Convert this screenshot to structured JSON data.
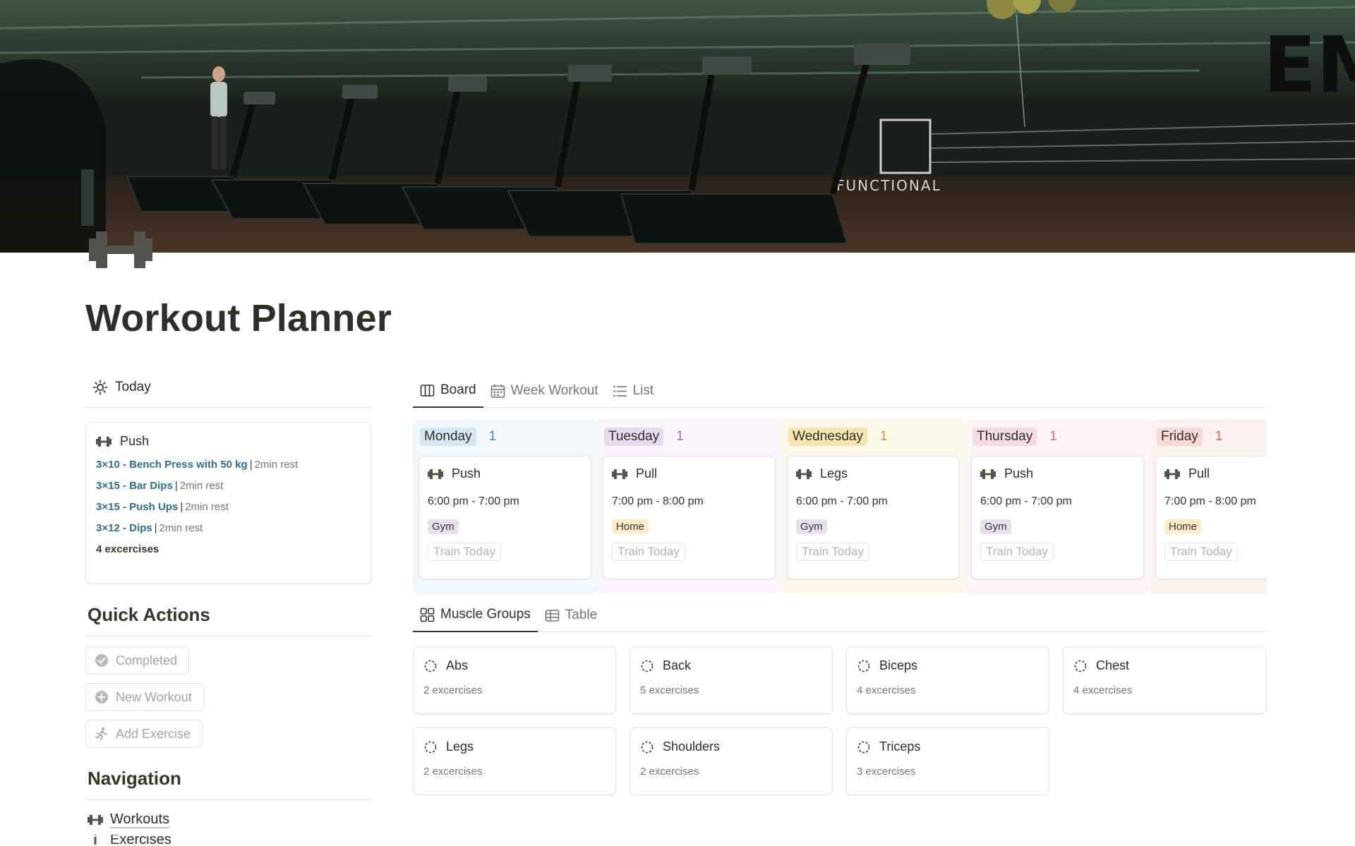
{
  "page": {
    "title": "Workout Planner",
    "icon": "dumbbell-icon",
    "cover": "gym-treadmills-photo"
  },
  "today": {
    "tab_label": "Today",
    "card": {
      "title": "Push",
      "exercises": [
        {
          "name": "3×10 - Bench Press with 50 kg",
          "rest": "2min rest"
        },
        {
          "name": "3×15 - Bar Dips",
          "rest": "2min rest"
        },
        {
          "name": "3×15 - Push Ups",
          "rest": "2min rest"
        },
        {
          "name": "3×12 - Dips",
          "rest": "2min rest"
        }
      ],
      "separator": "|",
      "count": "4 excercises"
    }
  },
  "quick_actions": {
    "heading": "Quick Actions",
    "buttons": [
      {
        "label": "Completed",
        "icon": "check-circle-icon"
      },
      {
        "label": "New Workout",
        "icon": "plus-circle-icon"
      },
      {
        "label": "Add Exercise",
        "icon": "running-person-icon"
      }
    ]
  },
  "navigation": {
    "heading": "Navigation",
    "items": [
      {
        "label": "Workouts",
        "icon": "dumbbell-icon"
      },
      {
        "label": "Exercises",
        "icon": "info-icon"
      }
    ]
  },
  "views": {
    "tabs": [
      {
        "label": "Board",
        "icon": "board-icon",
        "active": true
      },
      {
        "label": "Week Workout",
        "icon": "calendar-icon",
        "active": false
      },
      {
        "label": "List",
        "icon": "list-icon",
        "active": false
      }
    ]
  },
  "board": {
    "columns": [
      {
        "day": "Monday",
        "count": "1",
        "bg": "#f2f7fb",
        "tag_bg": "#d6e6f3",
        "count_color": "#4d88b3",
        "card": {
          "title": "Push",
          "time": "6:00 pm - 7:00 pm",
          "place": "Gym",
          "place_bg": "#e8deee",
          "button": "Train Today"
        }
      },
      {
        "day": "Tuesday",
        "count": "1",
        "bg": "#f9f5fb",
        "tag_bg": "#e6d9ef",
        "count_color": "#9a6eb5",
        "card": {
          "title": "Pull",
          "time": "7:00 pm - 8:00 pm",
          "place": "Home",
          "place_bg": "#fbecc7",
          "button": "Train Today"
        }
      },
      {
        "day": "Wednesday",
        "count": "1",
        "bg": "#fbf8ea",
        "tag_bg": "#f7e5b0",
        "count_color": "#c29a3a",
        "card": {
          "title": "Legs",
          "time": "6:00 pm - 7:00 pm",
          "place": "Gym",
          "place_bg": "#e8deee",
          "button": "Train Today"
        }
      },
      {
        "day": "Thursday",
        "count": "1",
        "bg": "#fbf3f6",
        "tag_bg": "#f5dbe6",
        "count_color": "#c06b91",
        "card": {
          "title": "Push",
          "time": "6:00 pm - 7:00 pm",
          "place": "Gym",
          "place_bg": "#e8deee",
          "button": "Train Today"
        }
      },
      {
        "day": "Friday",
        "count": "1",
        "bg": "#fcf2f1",
        "tag_bg": "#f8d9d5",
        "count_color": "#d0645a",
        "card": {
          "title": "Pull",
          "time": "7:00 pm - 8:00 pm",
          "place": "Home",
          "place_bg": "#fbecc7",
          "button": "Train Today"
        }
      }
    ]
  },
  "muscle_groups": {
    "tabs": [
      {
        "label": "Muscle Groups",
        "icon": "gallery-icon",
        "active": true
      },
      {
        "label": "Table",
        "icon": "table-icon",
        "active": false
      }
    ],
    "cards": [
      {
        "name": "Abs",
        "count": "2 excercises"
      },
      {
        "name": "Back",
        "count": "5 excercises"
      },
      {
        "name": "Biceps",
        "count": "4 excercises"
      },
      {
        "name": "Chest",
        "count": "4 excercises"
      },
      {
        "name": "Legs",
        "count": "2 excercises"
      },
      {
        "name": "Shoulders",
        "count": "2 excercises"
      },
      {
        "name": "Triceps",
        "count": "3 excercises"
      }
    ]
  }
}
